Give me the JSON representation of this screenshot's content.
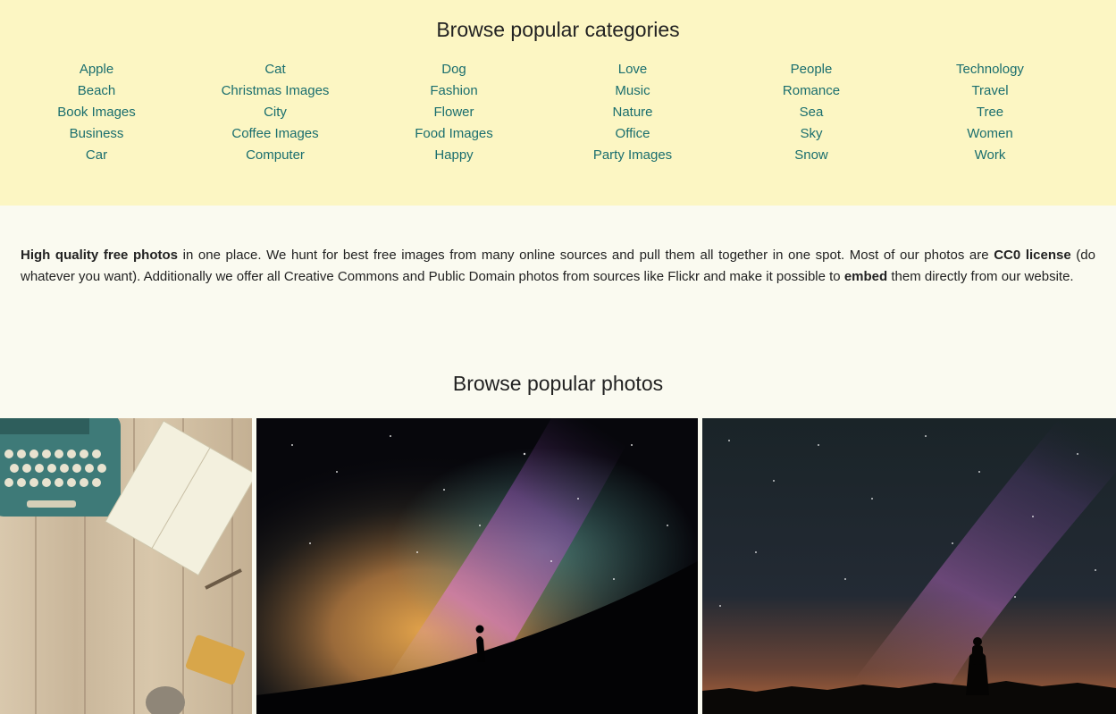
{
  "categories": {
    "title": "Browse popular categories",
    "columns": [
      [
        "Apple",
        "Beach",
        "Book Images",
        "Business",
        "Car"
      ],
      [
        "Cat",
        "Christmas Images",
        "City",
        "Coffee Images",
        "Computer"
      ],
      [
        "Dog",
        "Fashion",
        "Flower",
        "Food Images",
        "Happy"
      ],
      [
        "Love",
        "Music",
        "Nature",
        "Office",
        "Party Images"
      ],
      [
        "People",
        "Romance",
        "Sea",
        "Sky",
        "Snow"
      ],
      [
        "Technology",
        "Travel",
        "Tree",
        "Women",
        "Work"
      ]
    ]
  },
  "intro": {
    "bold1": "High quality free photos",
    "text1": " in one place. We hunt for best free images from many online sources and pull them all together in one spot. Most of our photos are ",
    "bold2": "CC0 license",
    "text2": " (do whatever you want). Additionally we offer all Creative Commons and Public Domain photos from sources like Flickr and make it possible to ",
    "bold3": "embed",
    "text3": " them directly from our website."
  },
  "photos": {
    "title": "Browse popular photos",
    "items": [
      {
        "subject": "typewriter-notebook-photo"
      },
      {
        "subject": "milky-way-silhouette-photo"
      },
      {
        "subject": "starry-sky-silhouette-photo"
      }
    ]
  },
  "colors": {
    "category_bg": "#fcf6c3",
    "page_bg": "#fafaf0",
    "link": "#1a6e6e"
  }
}
